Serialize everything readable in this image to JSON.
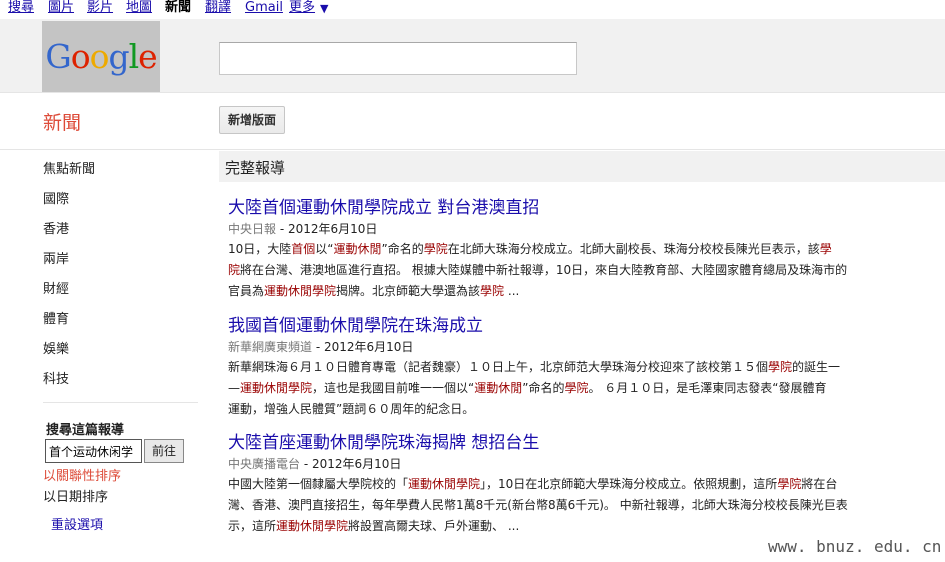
{
  "topnav": {
    "items": [
      "搜尋",
      "圖片",
      "影片",
      "地圖",
      "新聞",
      "翻譯",
      "Gmail",
      "更多"
    ],
    "more_arrow": "▼"
  },
  "header": {
    "logo_letters": [
      "G",
      "o",
      "o",
      "g",
      "l",
      "e"
    ],
    "logo_colors": [
      "#3366cc",
      "#dd2200",
      "#eeaa00",
      "#3366cc",
      "#119922",
      "#dd2200"
    ],
    "search_value": ""
  },
  "page": {
    "section_title": "新聞",
    "new_section_button": "新增版面"
  },
  "sidebar": {
    "items": [
      "焦點新聞",
      "國際",
      "香港",
      "兩岸",
      "財經",
      "體育",
      "娛樂",
      "科技"
    ],
    "search_title": "搜尋這篇報導",
    "search_value": "首个运动休闲学",
    "search_button": "前往",
    "sort_relevance": "以關聯性排序",
    "sort_date": "以日期排序",
    "reset_options": "重設選項"
  },
  "coverage": {
    "title": "完整報導"
  },
  "articles": [
    {
      "title": "大陸首個運動休閒學院成立  對台港澳直招",
      "source": "中央日報",
      "date": " - 2012年6月10日",
      "lines": [
        [
          [
            "10日，大陸",
            ""
          ],
          [
            "首個",
            "hl"
          ],
          [
            "以“",
            ""
          ],
          [
            "運動休閒",
            "hl"
          ],
          [
            "”命名的",
            ""
          ],
          [
            "學院",
            "hl"
          ],
          [
            "在北師大珠海分校成立。北師大副校長、珠海分校校長陳光巨表示，該",
            ""
          ],
          [
            "學",
            "hl"
          ]
        ],
        [
          [
            "院",
            "hl"
          ],
          [
            "將在台灣、港澳地區進行直招。 根據大陸媒體中新社報導，10日，來自大陸教育部、大陸國家體育總局及珠海市的",
            ""
          ]
        ],
        [
          [
            "官員為",
            ""
          ],
          [
            "運動休閒學院",
            "hl"
          ],
          [
            "揭牌。北京師範大學還為該",
            ""
          ],
          [
            "學院",
            "hl"
          ],
          [
            " ...",
            ""
          ]
        ]
      ]
    },
    {
      "title": "我國首個運動休閒學院在珠海成立",
      "source": "新華網廣東頻道",
      "date": " - 2012年6月10日",
      "lines": [
        [
          [
            "新華網珠海６月１０日體育專電（記者魏豪）１０日上午，北京師范大學珠海分校迎來了該校第１５個",
            ""
          ],
          [
            "學院",
            "hl"
          ],
          [
            "的誕生一",
            ""
          ]
        ],
        [
          [
            "—",
            ""
          ],
          [
            "運動休閒學院",
            "hl"
          ],
          [
            "，這也是我國目前唯一一個以“",
            ""
          ],
          [
            "運動休閒",
            "hl"
          ],
          [
            "”命名的",
            ""
          ],
          [
            "學院",
            "hl"
          ],
          [
            "。 ６月１０日，是毛澤東同志發表“發展體育",
            ""
          ]
        ],
        [
          [
            "運動，增強人民體質”題詞６０周年的紀念日。",
            ""
          ]
        ]
      ]
    },
    {
      "title": "大陸首座運動休閒學院珠海揭牌  想招台生",
      "source": "中央廣播電台",
      "date": " - 2012年6月10日",
      "lines": [
        [
          [
            "中國大陸第一個隸屬大學院校的「",
            ""
          ],
          [
            "運動休閒學院",
            "hl"
          ],
          [
            "」，10日在北京師範大學珠海分校成立。依照規劃，這所",
            ""
          ],
          [
            "學院",
            "hl"
          ],
          [
            "將在台",
            ""
          ]
        ],
        [
          [
            "灣、香港、澳門直接招生，每年學費人民幣1萬8千元(新台幣8萬6千元)。 中新社報導，北師大珠海分校校長陳光巨表",
            ""
          ]
        ],
        [
          [
            "示，這所",
            ""
          ],
          [
            "運動休閒學院",
            "hl"
          ],
          [
            "將設置高爾夫球、戶外運動、 ...",
            ""
          ]
        ]
      ]
    }
  ],
  "watermark": "www. bnuz. edu. cn"
}
